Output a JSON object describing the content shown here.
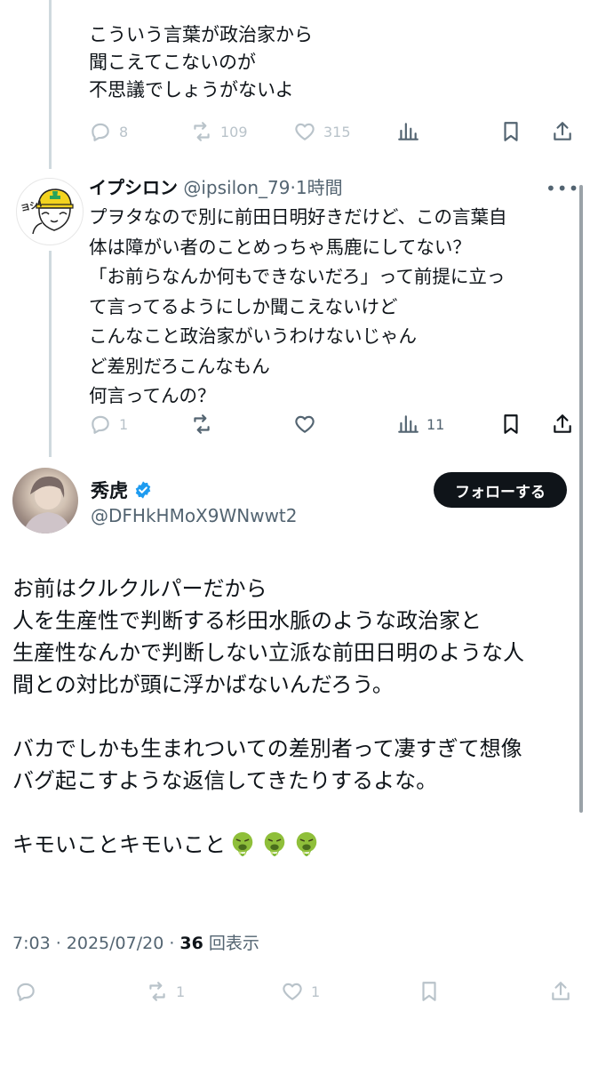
{
  "tweet1": {
    "text": "こういう言葉が政治家から\n聞こえてこないのが\n不思議でしょうがないよ",
    "replies": "8",
    "retweets": "109",
    "likes": "315"
  },
  "tweet2": {
    "display_name": "イプシロン",
    "handle": "@ipsilon_79",
    "time": "·1時間",
    "text": "プヲタなので別に前田日明好きだけど、この言葉自\n体は障がい者のことめっちゃ馬鹿にしてない？\n「お前らなんか何もできないだろ」って前提に立っ\nて言ってるようにしか聞こえないけど\nこんなこと政治家がいうわけないじゃん\nど差別だろこんなもん\n何言ってんの？",
    "avatar_text": "ヨシ!",
    "replies": "1",
    "views": "11"
  },
  "main_tweet": {
    "display_name": "秀虎",
    "handle": "@DFHkHMoX9WNwwt2",
    "follow_label": "フォローする",
    "para1": [
      "お前はクルクルパーだから",
      "人を生産性で判断する杉田水脈のような政治家と",
      "生産性なんかで判断しない立派な前田日明のような人",
      "間との対比が頭に浮かばないんだろう。"
    ],
    "para2": [
      "バカでしかも生まれついての差別者って凄すぎて想像",
      "バグ起こすような返信してきたりするよな。"
    ],
    "para3": "キモいことキモいこと",
    "emojis": [
      "vomiting-face",
      "vomiting-face",
      "vomiting-face"
    ],
    "meta_time": "7:03 · 2025/07/20 · ",
    "views_count": "36",
    "views_label": "回表示",
    "retweets": "1",
    "likes": "1"
  },
  "colors": {
    "text": "#0f1419",
    "secondary": "#536471",
    "verified": "#1d9bf0",
    "follow_bg": "#0f1419",
    "thread_line": "#cfd9de"
  }
}
